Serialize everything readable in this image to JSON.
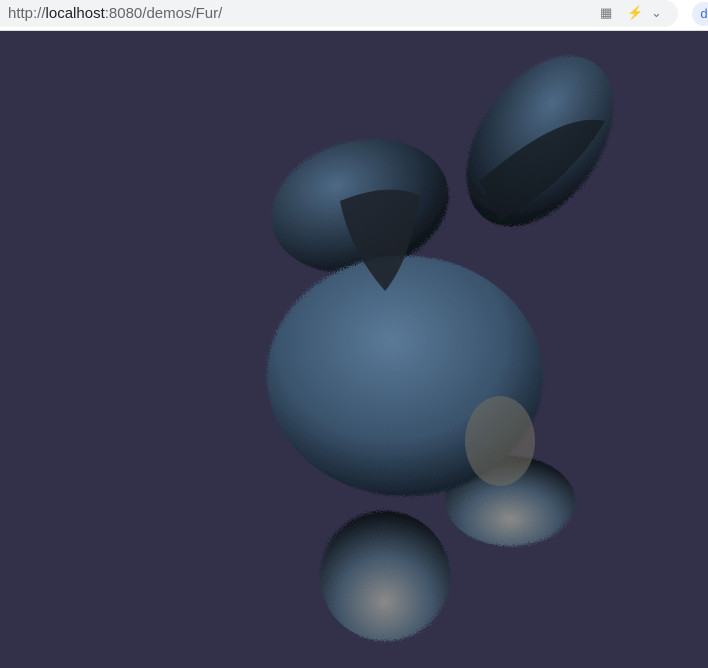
{
  "browser": {
    "url_scheme": "http://",
    "url_host": "localhost",
    "url_rest": ":8080/demos/Fur/",
    "icons": [
      "qr-code-icon",
      "lightning-icon",
      "chevron-down-icon",
      "extension-icon"
    ]
  },
  "scene": {
    "background": "#33304a",
    "subject": "fur-bunny"
  }
}
